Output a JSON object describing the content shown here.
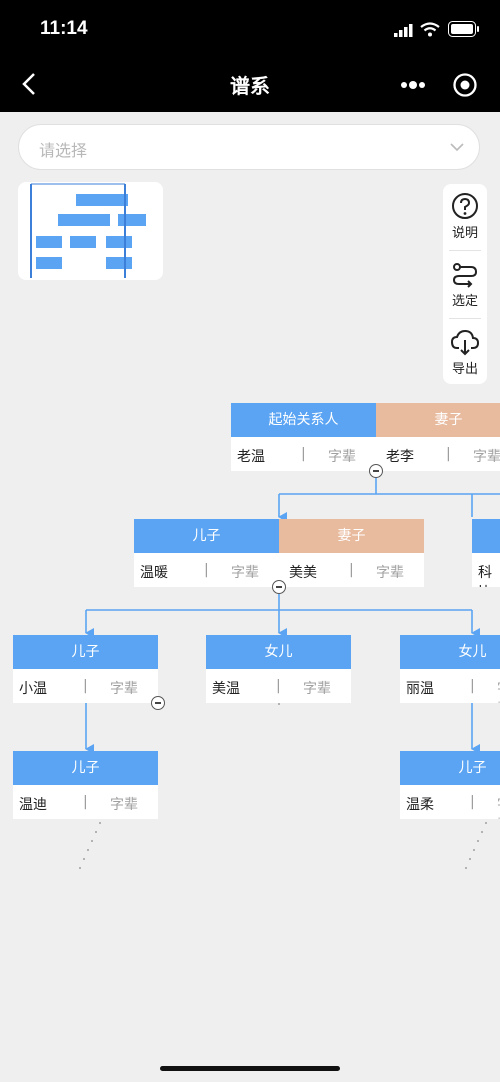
{
  "status": {
    "time": "11:14"
  },
  "nav": {
    "title": "谱系"
  },
  "search": {
    "placeholder": "请选择"
  },
  "toolbar": {
    "help": "说明",
    "select": "选定",
    "export": "导出"
  },
  "tree": {
    "root": {
      "role": "起始关系人",
      "name": "老温",
      "gen": "字辈",
      "spouse_role": "妻子",
      "spouse_name": "老李",
      "spouse_gen": "字辈"
    },
    "gen1": [
      {
        "role": "儿子",
        "name": "温暖",
        "gen": "字辈",
        "spouse_role": "妻子",
        "spouse_name": "美美",
        "spouse_gen": "字辈"
      },
      {
        "name": "科比"
      }
    ],
    "gen2": [
      {
        "role": "儿子",
        "name": "小温",
        "gen": "字辈"
      },
      {
        "role": "女儿",
        "name": "美温",
        "gen": "字辈"
      },
      {
        "role": "女儿",
        "name": "丽温",
        "gen": "字辈"
      }
    ],
    "gen3": [
      {
        "role": "儿子",
        "name": "温迪",
        "gen": "字辈"
      },
      {
        "role": "儿子",
        "name": "温柔",
        "gen": "字辈"
      }
    ]
  }
}
